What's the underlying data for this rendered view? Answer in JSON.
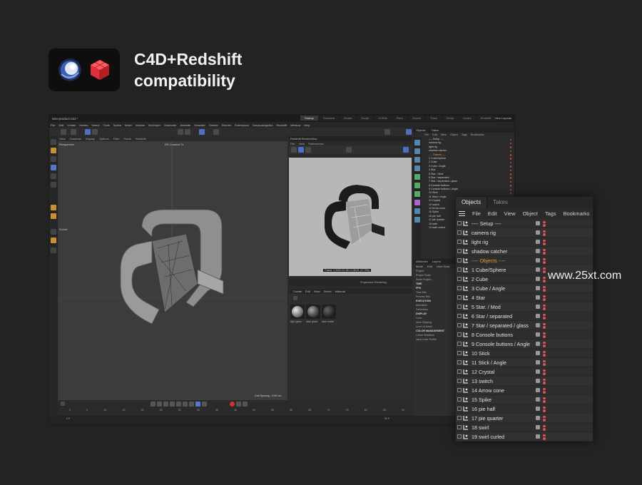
{
  "header": {
    "title_line1": "C4D+Redshift",
    "title_line2": "compatibility"
  },
  "watermark": "www.25xt.com",
  "colors": {
    "background": "#232323",
    "accent_blue": "#4f6fc4",
    "redshift_red": "#e0313a",
    "setup_orange": "#e69b3a",
    "dot_red": "#e05050"
  },
  "app": {
    "doc_tab": "intro-product.c4d *",
    "layout_tabs": [
      "Startup",
      "Standard",
      "Model",
      "Sculpt",
      "UVEdit",
      "Paint",
      "Groom",
      "Track",
      "Script",
      "Nodes",
      "Redshift"
    ],
    "new_layouts": "New Layouts",
    "menu": [
      "File",
      "Edit",
      "Create",
      "Modes",
      "Select",
      "Tools",
      "Spline",
      "Mesh",
      "Volume",
      "MoGraph",
      "Character",
      "Animate",
      "Simulate",
      "Tracker",
      "Render",
      "Extensions",
      "Greyscalegorilla",
      "Redshift",
      "Window",
      "Help"
    ],
    "viewport": {
      "menu": [
        "View",
        "Cameras",
        "Display",
        "Options",
        "Filter",
        "Panel",
        "Redshift"
      ],
      "label": "Perspective",
      "camera": "RS Camera Tx",
      "rotate_label": "Rotate",
      "grid_spacing": "Grid Spacing : 1000 cm"
    },
    "renderview": {
      "title": "Redshift RenderView",
      "menu": [
        "File",
        "View",
        "Preferences"
      ],
      "frame_info": "Frame: 0   2022-07-08   14:36:01  (17.20s)",
      "status": "Progressive Rendering..."
    },
    "materials": {
      "menu": [
        "Create",
        "Edit",
        "View",
        "Select",
        "Material"
      ],
      "items": [
        "light glass",
        "dark glass",
        "dark matte"
      ]
    },
    "timeline": {
      "ticks": [
        "0",
        "5",
        "10",
        "15",
        "20",
        "25",
        "30",
        "35",
        "40",
        "45",
        "50",
        "55",
        "60",
        "65",
        "70",
        "75",
        "80",
        "85",
        "90"
      ],
      "frame_start": "0 F",
      "frame_end": "90 F"
    },
    "right_panel": {
      "tabs": [
        "Objects",
        "Takes"
      ],
      "menu": [
        "File",
        "Edit",
        "View",
        "Object",
        "Tags",
        "Bookmarks"
      ],
      "attr_tabs": [
        "Attributes",
        "Layers"
      ],
      "attr_menu": [
        "Mode",
        "Edit",
        "User Data"
      ],
      "attr_rows": [
        "Project",
        "Project Scale",
        "Scale Project...",
        "TIME",
        "FPS",
        "Time Min",
        "Preview Min",
        "EXECUTION",
        "Animation",
        "Deformers",
        "DISPLAY",
        "Color",
        "View Clipping",
        "Level of Detail",
        "COLOR MANAGEMENT",
        "Linear Workflow",
        "Input Color Profile"
      ]
    }
  },
  "objects_panel": {
    "tabs": [
      "Objects",
      "Takes"
    ],
    "menu": [
      "File",
      "Edit",
      "View",
      "Object",
      "Tags",
      "Bookmarks"
    ],
    "items": [
      {
        "name": "---- Setup ----",
        "orange": false
      },
      {
        "name": "camera rig",
        "orange": false
      },
      {
        "name": "light rig",
        "orange": false
      },
      {
        "name": "shadow catcher",
        "orange": false
      },
      {
        "name": "---- Objects ----",
        "orange": true
      },
      {
        "name": "1 Cube/Sphere",
        "orange": false
      },
      {
        "name": "2 Cube",
        "orange": false
      },
      {
        "name": "3 Cube / Angle",
        "orange": false
      },
      {
        "name": "4 Star",
        "orange": false
      },
      {
        "name": "5 Star. / Mod",
        "orange": false
      },
      {
        "name": "6 Star / separated",
        "orange": false
      },
      {
        "name": "7 Star / separated / glass",
        "orange": false
      },
      {
        "name": "8 Console buttons",
        "orange": false
      },
      {
        "name": "9 Console buttons / Angle",
        "orange": false
      },
      {
        "name": "10 Stick",
        "orange": false
      },
      {
        "name": "11 Stick / Angle",
        "orange": false
      },
      {
        "name": "12 Crystal",
        "orange": false
      },
      {
        "name": "13  switch",
        "orange": false
      },
      {
        "name": "14 Arrow cone",
        "orange": false
      },
      {
        "name": "15 Spike",
        "orange": false
      },
      {
        "name": "16 pie half",
        "orange": false
      },
      {
        "name": "17 pie quarter",
        "orange": false
      },
      {
        "name": "18 swirl",
        "orange": false
      },
      {
        "name": "19 swirl curled",
        "orange": false
      }
    ]
  }
}
